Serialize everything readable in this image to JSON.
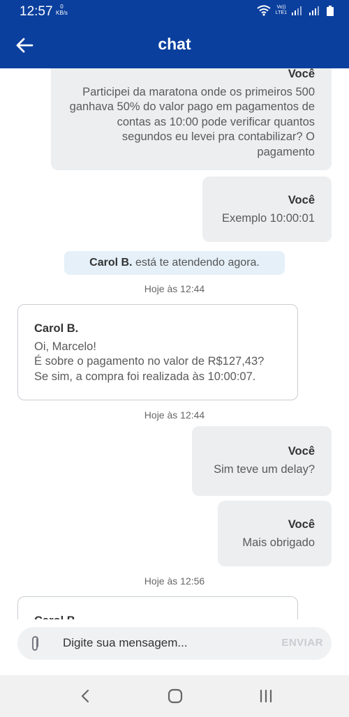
{
  "status_bar": {
    "time": "12:57",
    "net_speed_value": "0",
    "net_speed_unit": "KB/s",
    "volte": "Vo))",
    "lte": "LTE1"
  },
  "header": {
    "title": "chat"
  },
  "messages": {
    "m1": {
      "who": "Você",
      "text": "Participei da maratona onde os primeiros 500 ganhava 50% do valor pago em pagamentos de contas as 10:00 pode verificar quantos segundos eu levei pra contabilizar? O pagamento"
    },
    "m2": {
      "who": "Você",
      "text": "Exemplo 10:00:01"
    },
    "notice": {
      "name": "Carol B.",
      "text": "está te atendendo agora."
    },
    "time1": "Hoje às 12:44",
    "m3": {
      "who": "Carol B.",
      "line1": "Oi, Marcelo!",
      "line2": "É sobre o pagamento no valor de R$127,43?",
      "line3": "Se sim, a compra foi realizada às 10:00:07."
    },
    "time2": "Hoje às 12:44",
    "m4": {
      "who": "Você",
      "text": "Sim teve um delay?"
    },
    "m5": {
      "who": "Você",
      "text": "Mais obrigado"
    },
    "time3": "Hoje às 12:56",
    "m6": {
      "who": "Carol B."
    }
  },
  "composer": {
    "placeholder": "Digite sua mensagem...",
    "send_label": "ENVIAR"
  },
  "colors": {
    "brand": "#0a3f9e",
    "bubble_me": "#eceef0",
    "notice_bg": "#e5f0f8",
    "send_disabled": "#c9ccd1"
  },
  "icons": {
    "back": "arrow-left-icon",
    "attach": "paperclip-icon",
    "nav_back": "chevron-left-icon",
    "nav_home": "home-square-icon",
    "nav_recent": "recents-bars-icon"
  }
}
